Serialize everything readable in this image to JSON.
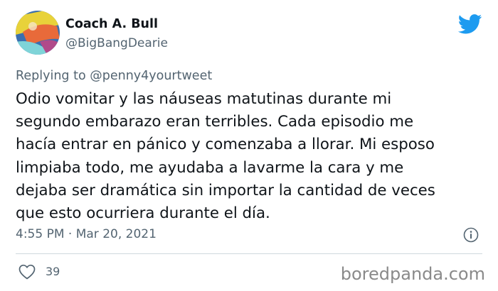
{
  "author": {
    "display_name": "Coach A. Bull",
    "handle": "@BigBangDearie"
  },
  "reply": {
    "prefix": "Replying to ",
    "mention": "@penny4yourtweet"
  },
  "tweet": {
    "lines": [
      "Odio vomitar y las náuseas matutinas durante mi",
      "segundo embarazo eran terribles. Cada episodio me",
      "hacía entrar en pánico y comenzaba a llorar. Mi esposo",
      "limpiaba todo, me ayudaba a lavarme la cara y me",
      "dejaba ser dramática sin importar la cantidad de veces",
      "que esto ocurriera durante el día."
    ]
  },
  "meta": {
    "time": "4:55 PM",
    "separator": " · ",
    "date": "Mar 20, 2021"
  },
  "actions": {
    "like_count": "39"
  },
  "watermark": "boredpanda.com",
  "icons": {
    "brand": "twitter-bird-icon",
    "info": "info-icon",
    "like": "heart-icon"
  },
  "colors": {
    "brand_blue": "#1d9bf0",
    "text": "#0f1419",
    "secondary": "#536471",
    "watermark": "#8a8a8a"
  }
}
